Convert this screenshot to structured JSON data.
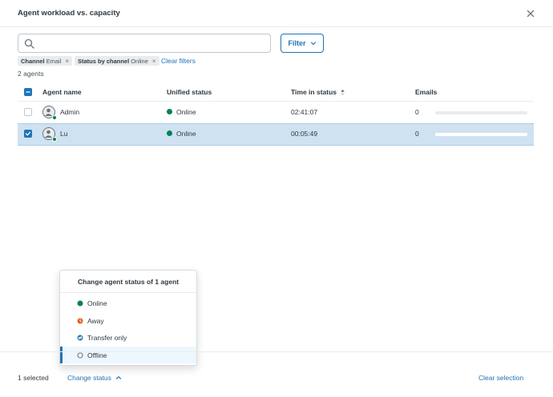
{
  "header": {
    "title": "Agent workload vs. capacity"
  },
  "search": {
    "value": "",
    "placeholder": ""
  },
  "filter": {
    "label": "Filter"
  },
  "filters": {
    "tags": [
      {
        "key": "Channel",
        "value": "Email"
      },
      {
        "key": "Status by channel",
        "value": "Online"
      }
    ],
    "clear_label": "Clear filters"
  },
  "agent_count": "2 agents",
  "table": {
    "columns": [
      "Agent name",
      "Unified status",
      "Time in status",
      "Emails"
    ],
    "rows": [
      {
        "name": "Admin",
        "status": "Online",
        "time": "02:41:07",
        "emails": "0",
        "selected": false,
        "capacity_fill": 0
      },
      {
        "name": "Lu",
        "status": "Online",
        "time": "00:05:49",
        "emails": "0",
        "selected": true,
        "capacity_fill": 0
      }
    ]
  },
  "dropdown": {
    "title": "Change agent status of 1 agent",
    "options": [
      {
        "label": "Online",
        "icon": "online-dot-icon",
        "color": "#038153"
      },
      {
        "label": "Away",
        "icon": "away-clock-icon",
        "color": "#e35b1e"
      },
      {
        "label": "Transfer only",
        "icon": "transfer-arrows-icon",
        "color": "#1f73b7"
      },
      {
        "label": "Offline",
        "icon": "offline-ring-icon",
        "color": "#68737d"
      }
    ],
    "active_option": "Offline"
  },
  "footer": {
    "selected": "1 selected",
    "change_status": "Change status",
    "clear_selection": "Clear selection"
  },
  "colors": {
    "accent": "#1f73b7",
    "online": "#038153",
    "selected_row": "#cee2f2"
  }
}
